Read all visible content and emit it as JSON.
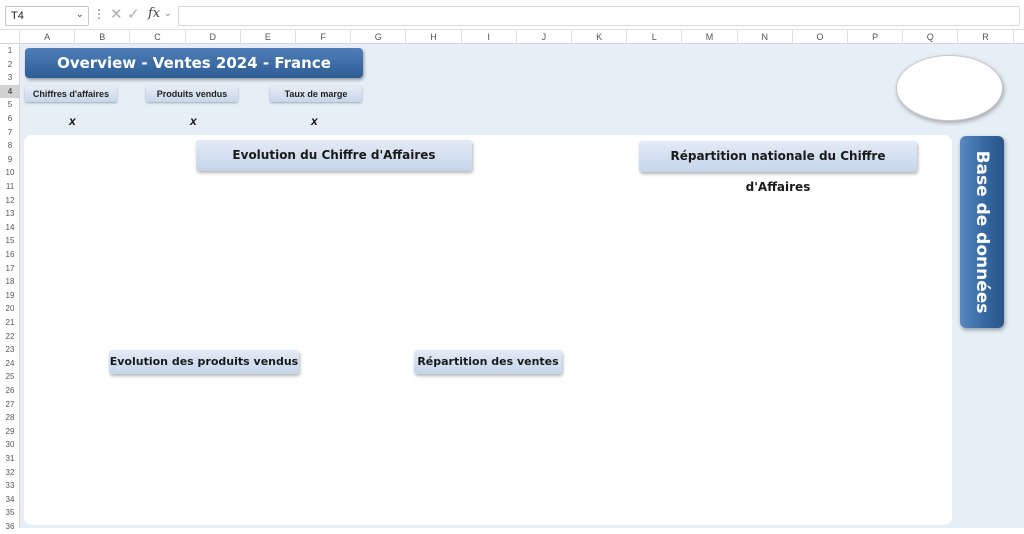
{
  "formula_bar": {
    "name_box": "T4",
    "cancel_icon": "close-icon",
    "enter_icon": "check-icon",
    "fx_label": "fx",
    "formula": ""
  },
  "columns": [
    "A",
    "B",
    "C",
    "D",
    "E",
    "F",
    "G",
    "H",
    "I",
    "J",
    "K",
    "L",
    "M",
    "N",
    "O",
    "P",
    "Q",
    "R"
  ],
  "rows": [
    "1",
    "2",
    "3",
    "4",
    "5",
    "6",
    "7",
    "8",
    "9",
    "10",
    "11",
    "12",
    "13",
    "14",
    "15",
    "16",
    "17",
    "18",
    "19",
    "20",
    "21",
    "22",
    "23",
    "24",
    "25",
    "26",
    "27",
    "28",
    "29",
    "30",
    "31",
    "32",
    "33",
    "34",
    "35",
    "36"
  ],
  "selected_row": "4",
  "dashboard": {
    "title": "Overview -  Ventes 2024 - France",
    "buttons": [
      "Chiffres d'affaires",
      "Produits vendus",
      "Taux de marge"
    ],
    "markers": [
      "x",
      "x",
      "x"
    ],
    "chart_titles": {
      "ca_evolution": "Evolution du Chiffre d'Affaires",
      "ca_repartition": "Répartition nationale du Chiffre d'Affaires",
      "produits_evolution": "Evolution des produits vendus",
      "ventes_repartition": "Répartition des ventes"
    },
    "database_button": "Base de données"
  }
}
